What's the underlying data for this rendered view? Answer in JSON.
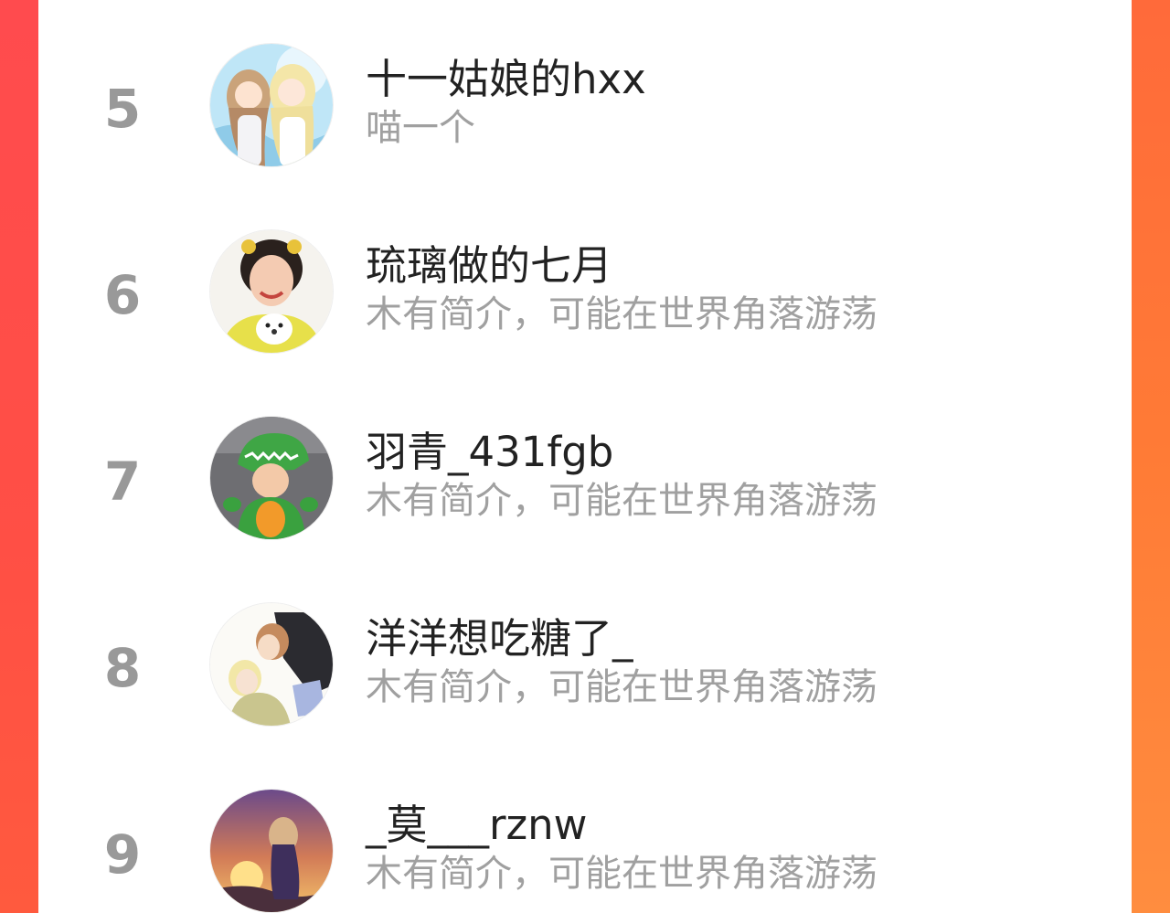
{
  "ranking": {
    "items": [
      {
        "rank": "5",
        "name": "十一姑娘的hxx",
        "bio": "喵一个",
        "avatar_icon": "anime-girls-avatar"
      },
      {
        "rank": "6",
        "name": "琉璃做的七月",
        "bio": "木有简介，可能在世界角落游荡",
        "avatar_icon": "woman-with-puppy-avatar"
      },
      {
        "rank": "7",
        "name": "羽青_431fgb",
        "bio": "木有简介，可能在世界角落游荡",
        "avatar_icon": "child-dinosaur-costume-avatar"
      },
      {
        "rank": "8",
        "name": "洋洋想吃糖了_",
        "bio": "木有简介，可能在世界角落游荡",
        "avatar_icon": "anime-couple-avatar"
      },
      {
        "rank": "9",
        "name": "_莫___rznw",
        "bio": "木有简介，可能在世界角落游荡",
        "avatar_icon": "anime-sunset-girl-avatar"
      }
    ]
  },
  "colors": {
    "accent_left": "#ff4b4e",
    "accent_right": "#ff7b36",
    "rank_gray": "#999999",
    "name_color": "#222222",
    "bio_color": "#a0a0a0"
  }
}
